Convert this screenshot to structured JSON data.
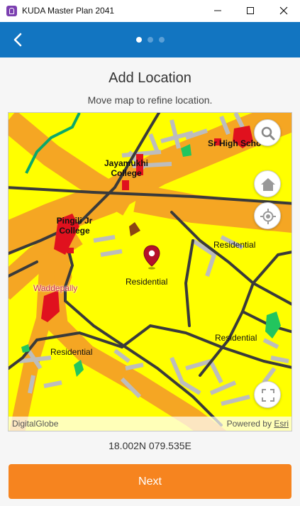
{
  "window": {
    "title": "KUDA Master Plan 2041"
  },
  "appbar": {
    "back_icon": "chevron-left-icon",
    "steps_total": 3,
    "step_active": 1
  },
  "page": {
    "title": "Add Location",
    "subtitle": "Move map to refine location.",
    "coordinates": "18.002N 079.535E",
    "next_label": "Next"
  },
  "map": {
    "labels": {
      "school": "Sr High Scho",
      "college1": "Jayamukhi College",
      "college2": "Pingili Jr College",
      "residential_center": "Residential",
      "residential_east": "Residential",
      "residential_southeast": "Residential",
      "residential_southwest": "Residential",
      "waddepally": "Waddepally"
    },
    "attribution": {
      "source": "DigitalGlobe",
      "powered_by": "Powered by",
      "esri": "Esri"
    },
    "controls": [
      "search-icon",
      "home-icon",
      "locate-icon",
      "fullscreen-icon"
    ],
    "colors": {
      "residential": "#ffff00",
      "major_road": "#f5a623",
      "minor_road": "#bdbdbd",
      "road": "#3a3a3a",
      "institution": "#e0111e",
      "park": "#22c55e",
      "pin": "#b5122a"
    }
  },
  "colors": {
    "appbar": "#1275c1",
    "next_button": "#f6841f"
  }
}
